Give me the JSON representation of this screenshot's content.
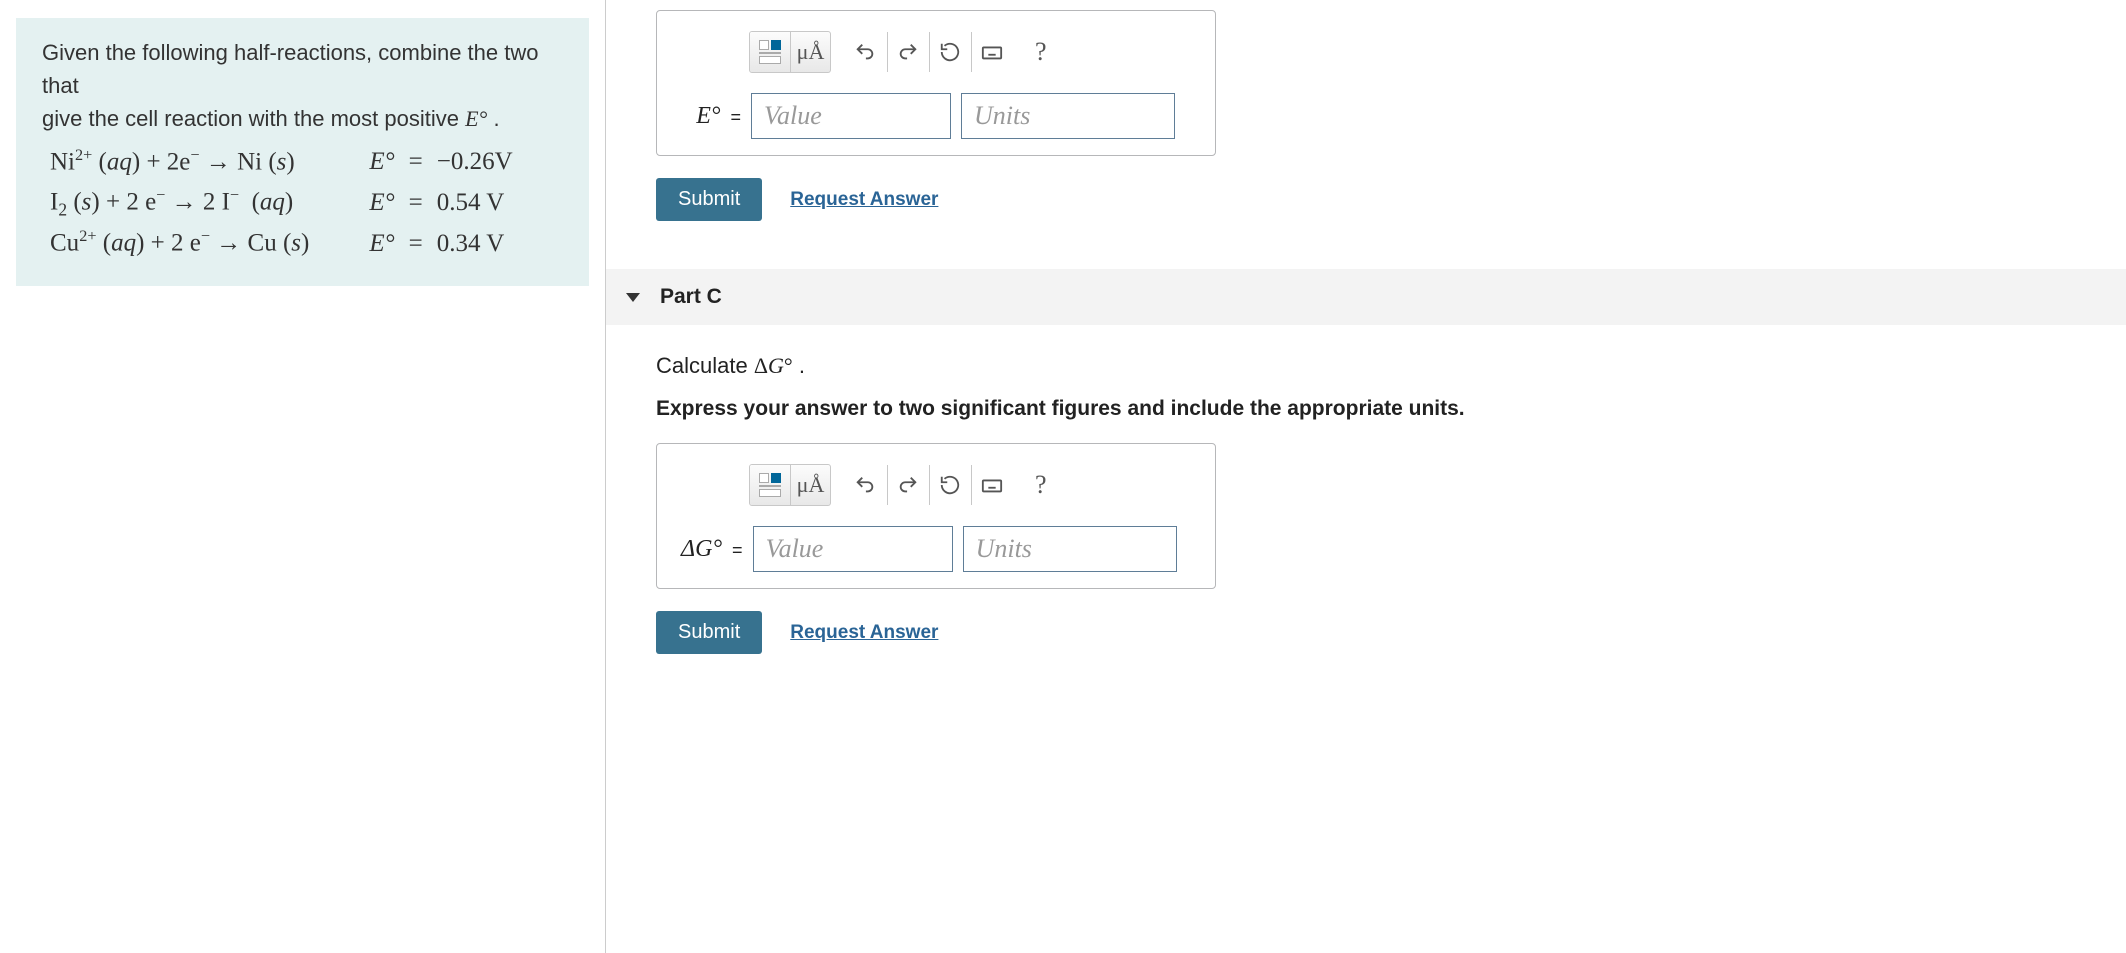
{
  "question": {
    "prompt_line1": "Given the following half-reactions, combine the two that",
    "prompt_line2": "give the cell reaction with the most positive ",
    "eq_symbol": "E°",
    "half_reactions": [
      {
        "rxn_html": "Ni<sup>2+</sup> (<i>aq</i>) + 2e<sup>−</sup> → Ni (<i>s</i>)",
        "e_label": "E°",
        "eq": "=",
        "val": "−0.26V"
      },
      {
        "rxn_html": "I<sub>2</sub> (<i>s</i>) + 2 e<sup>−</sup> → 2 I<sup>−</sup> (<i>aq</i>)",
        "e_label": "E°",
        "eq": "=",
        "val": "0.54 V"
      },
      {
        "rxn_html": "Cu<sup>2+</sup> (<i>aq</i>) + 2 e<sup>−</sup> → Cu (<i>s</i>)",
        "e_label": "E°",
        "eq": "=",
        "val": "0.34 V"
      }
    ]
  },
  "part_b": {
    "toolbar": {
      "units": "μÅ",
      "help": "?"
    },
    "label_html": "E° =",
    "value_placeholder": "Value",
    "units_placeholder": "Units",
    "submit": "Submit",
    "request": "Request Answer"
  },
  "part_c": {
    "header": "Part C",
    "instr_prefix": "Calculate ",
    "instr_symbol": "ΔG°",
    "instr_suffix": " .",
    "instr2": "Express your answer to two significant figures and include the appropriate units.",
    "toolbar": {
      "units": "μÅ",
      "help": "?"
    },
    "label_html": "ΔG° =",
    "value_placeholder": "Value",
    "units_placeholder": "Units",
    "submit": "Submit",
    "request": "Request Answer"
  }
}
